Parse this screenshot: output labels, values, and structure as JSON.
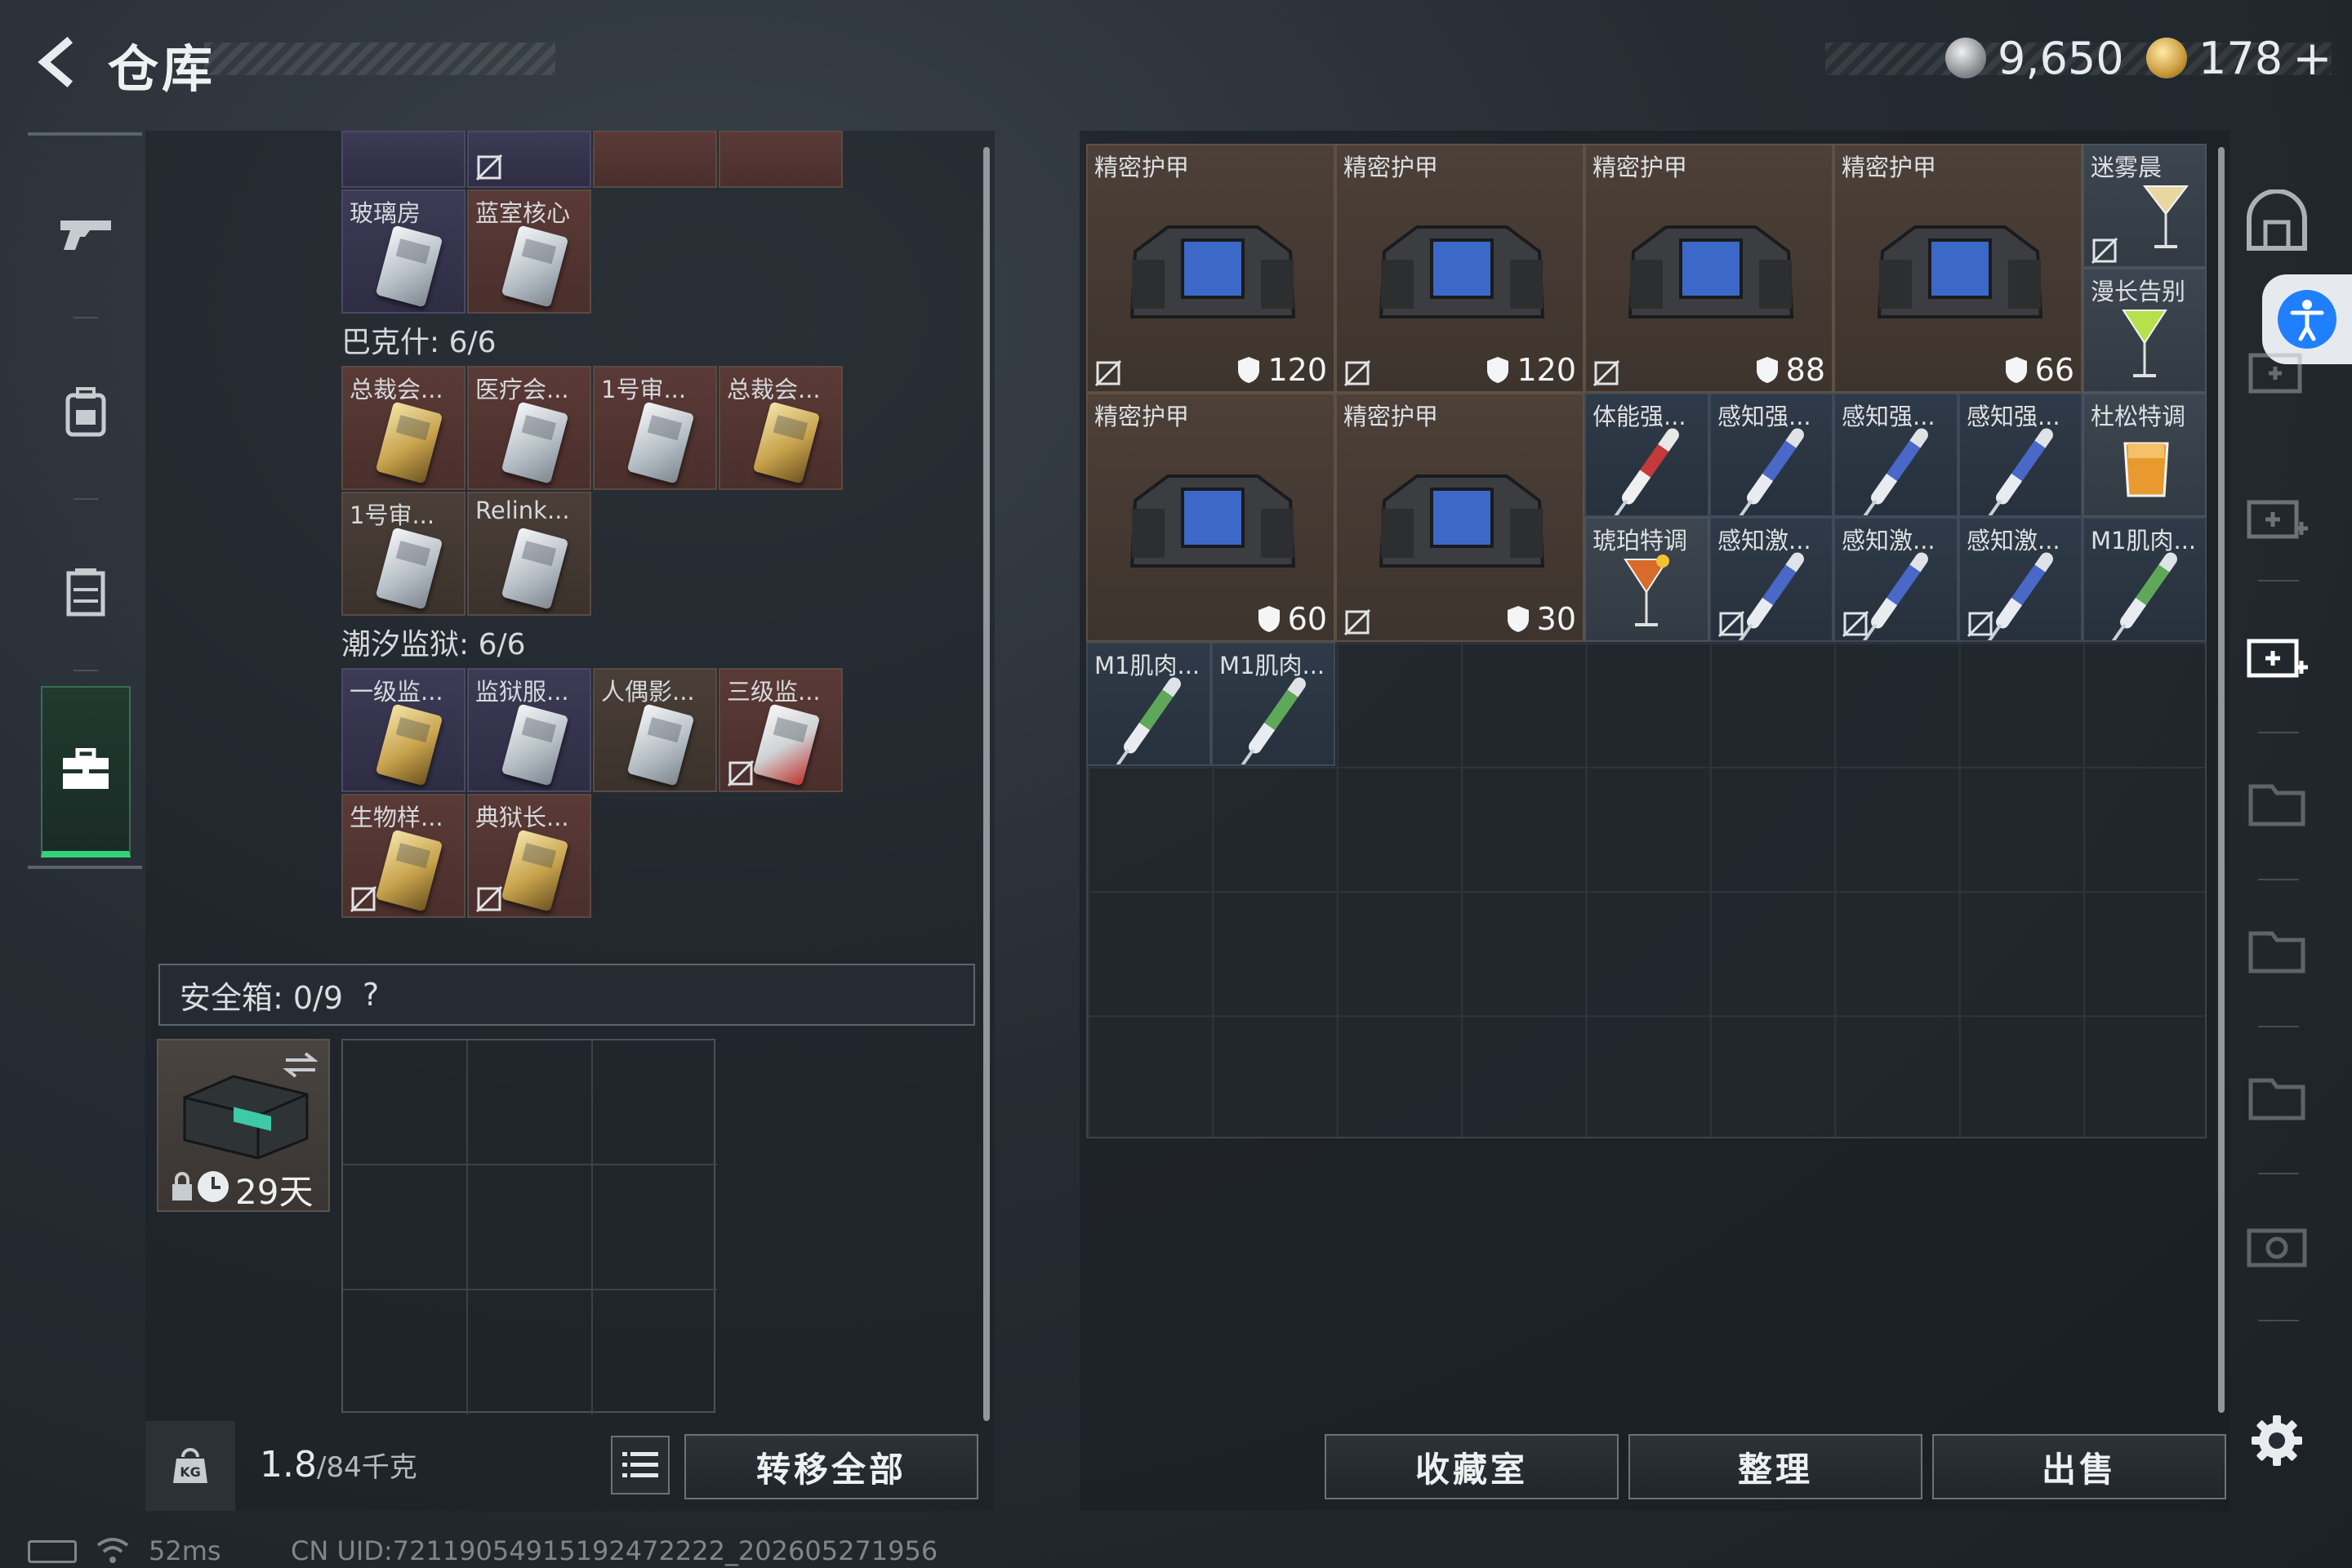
{
  "header": {
    "title": "仓库",
    "currency_silver": "9,650",
    "currency_gold": "178",
    "currency_plus": "+"
  },
  "nav": {
    "items": [
      "weapon",
      "backpack",
      "vest",
      "toolbox"
    ],
    "active": "toolbox"
  },
  "left_panel": {
    "top_row_partial": [
      {
        "label": "",
        "color": "purple"
      },
      {
        "label": "",
        "color": "purple"
      },
      {
        "label": "",
        "color": "red"
      },
      {
        "label": "",
        "color": "red"
      }
    ],
    "row_glass": [
      {
        "label": "玻璃房",
        "color": "purple"
      },
      {
        "label": "蓝室核心",
        "color": "red"
      }
    ],
    "section_bakshi": {
      "title": "巴克什: 6/6",
      "row1": [
        "总裁会...",
        "医疗会...",
        "1号审...",
        "总裁会..."
      ],
      "row2": [
        "1号审...",
        "Relink..."
      ]
    },
    "section_tidal_prison": {
      "title": "潮汐监狱: 6/6",
      "row1": [
        "一级监...",
        "监狱服...",
        "人偶影...",
        "三级监..."
      ],
      "row2": [
        "生物样...",
        "典狱长..."
      ]
    },
    "safebox": {
      "label": "安全箱: 0/9",
      "help": "?",
      "timer": "29天"
    },
    "weight": {
      "current": "1.8",
      "max": "/84千克"
    },
    "transfer_all_label": "转移全部"
  },
  "inventory": {
    "armor_items": [
      {
        "label": "精密护甲",
        "durability": "120"
      },
      {
        "label": "精密护甲",
        "durability": "120"
      },
      {
        "label": "精密护甲",
        "durability": "88"
      },
      {
        "label": "精密护甲",
        "durability": "66"
      },
      {
        "label": "精密护甲",
        "durability": "60"
      },
      {
        "label": "精密护甲",
        "durability": "30"
      }
    ],
    "small_items": [
      {
        "label": "迷雾晨",
        "kind": "drink"
      },
      {
        "label": "漫长告别",
        "kind": "drink"
      },
      {
        "label": "体能强...",
        "kind": "injector",
        "color": "red"
      },
      {
        "label": "感知强...",
        "kind": "injector",
        "color": "blue"
      },
      {
        "label": "感知强...",
        "kind": "injector",
        "color": "blue"
      },
      {
        "label": "感知强...",
        "kind": "injector",
        "color": "blue"
      },
      {
        "label": "杜松特调",
        "kind": "drink"
      },
      {
        "label": "琥珀特调",
        "kind": "drink"
      },
      {
        "label": "感知激...",
        "kind": "injector",
        "color": "blue"
      },
      {
        "label": "感知激...",
        "kind": "injector",
        "color": "blue"
      },
      {
        "label": "感知激...",
        "kind": "injector",
        "color": "blue"
      },
      {
        "label": "M1肌肉...",
        "kind": "injector",
        "color": "green"
      },
      {
        "label": "M1肌肉...",
        "kind": "injector",
        "color": "green"
      },
      {
        "label": "M1肌肉...",
        "kind": "injector",
        "color": "green"
      }
    ]
  },
  "actions": {
    "collection_label": "收藏室",
    "sort_label": "整理",
    "sell_label": "出售"
  },
  "status_bar": {
    "ping": "52ms",
    "uid": "CN UID:72119054915192472222_202605271956"
  },
  "colors": {
    "accent_green": "#35d17a",
    "help_blue": "#1f7fff"
  }
}
